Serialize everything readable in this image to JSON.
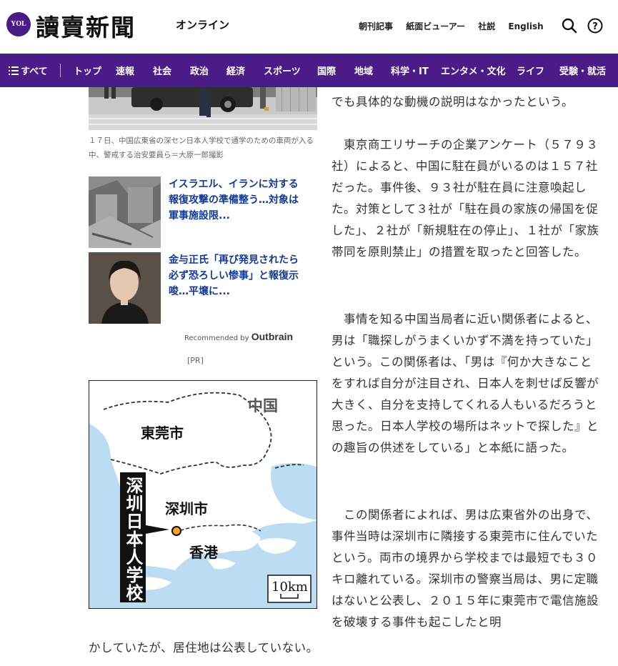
{
  "header": {
    "logo_badge": "YOL",
    "logo_title": "讀賣新聞",
    "logo_sub": "オンライン",
    "links": [
      "朝刊記事",
      "紙面ビューアー",
      "社説",
      "English"
    ]
  },
  "nav": {
    "all_label": "すべて",
    "items": [
      "トップ",
      "速報",
      "社会",
      "政治",
      "経済",
      "スポーツ",
      "国際",
      "地域",
      "科学・IT",
      "エンタメ・文化",
      "ライフ",
      "受験・就活"
    ]
  },
  "photo_caption": "１７日、中国広東省の深セン日本人学校で通学のための車両が入る中、警戒する治安要員ら＝大原一郎撮影",
  "recommended": [
    {
      "title": "イスラエル、イランに対する報復攻撃の準備整う…対象は軍事施設限..."
    },
    {
      "title": "金与正氏「再び発見されたら必ず恐ろしい惨事」と報復示唆…平壌に..."
    }
  ],
  "outbrain": {
    "label": "Recommended by",
    "brand": "Outbrain"
  },
  "pr_label": "[PR]",
  "map": {
    "china": "中国",
    "dongguan": "東莞市",
    "shenzhen": "深圳市",
    "hongkong": "香港",
    "school": "深圳日本人学校",
    "scale": "10km"
  },
  "article": {
    "p0": "でも具体的な動機の説明はなかったという。",
    "p1": "　東京商工リサーチの企業アンケート（５７９３社）によると、中国に駐在員がいるのは１５７社だった。事件後、９３社が駐在員に注意喚起した。対策として３社が「駐在員の家族の帰国を促した」、２社が「新規駐在の停止」、１社が「家族帯同を原則禁止」の措置を取ったと回答した。",
    "p2": "　事情を知る中国当局者に近い関係者によると、男は「職探しがうまくいかず不満を持っていた」という。この関係者は、「男は『何か大きなことをすれば自分が注目され、日本人を刺せば反響が大きく、自分を支持してくれる人もいるだろうと思った。日本人学校の場所はネットで探した』との趣旨の供述をしている」と本紙に語った。",
    "p3a": "　この関係者によれば、男は広東省外の出身で、事件当時は深圳市に隣接する東莞市に住んでいたという。両市の境界から学校までは最短でも３０キロ離れている。深圳市の警察当局は、男に定職はないと公表し、２０１５年に東莞市で電信施設を破壊する事件も起こしたと明",
    "p3b": "かしていたが、居住地は公表していない。"
  }
}
